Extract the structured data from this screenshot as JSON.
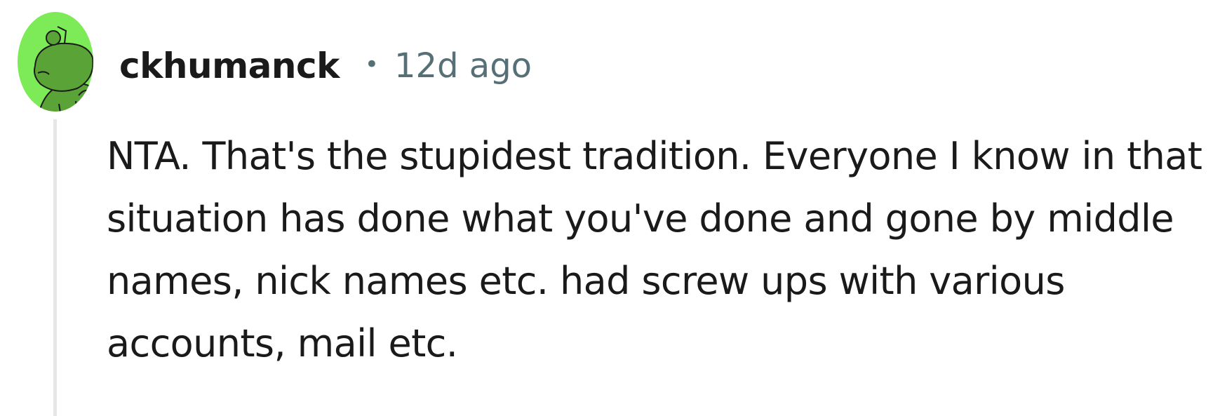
{
  "comment": {
    "author": "ckhumanck",
    "separator": "•",
    "timestamp": "12d ago",
    "body": "NTA. That's the stupidest tradition. Everyone I know in that situation has done what you've done and gone by middle names, nick names etc. had screw ups with various accounts, mail etc."
  },
  "avatar": {
    "icon": "snoo-avatar-icon",
    "background_color": "#7dea58",
    "figure_color": "#5aa336"
  },
  "colors": {
    "author_text": "#1a1a1b",
    "meta_text": "#576f76",
    "body_text": "#1a1a1b",
    "thread_line": "#e5e7e8"
  }
}
